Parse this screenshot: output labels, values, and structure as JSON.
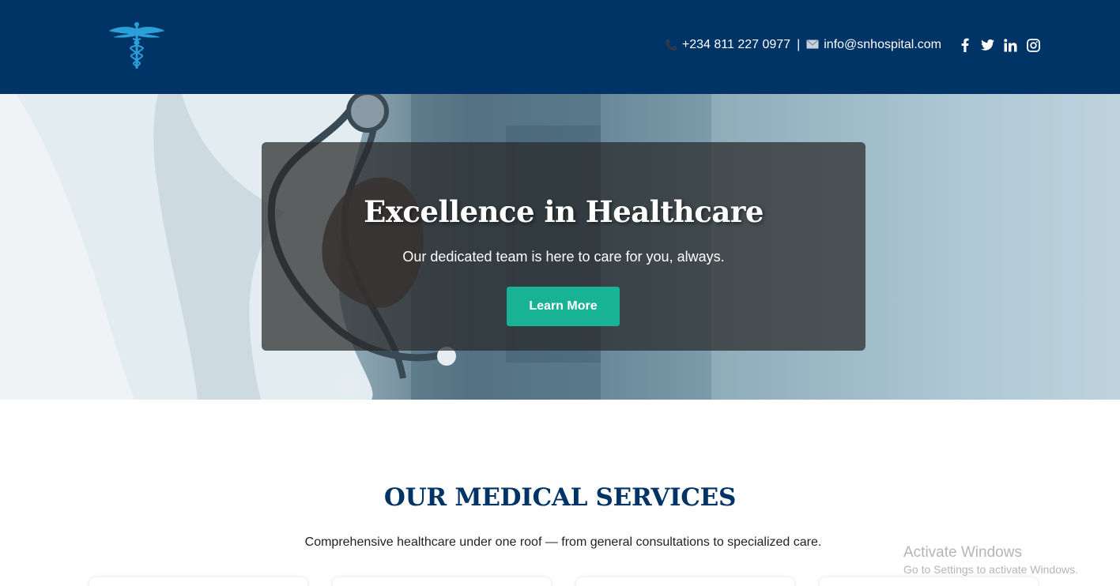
{
  "header": {
    "phone": "+234 811 227 0977",
    "separator": "|",
    "email": "info@snhospital.com",
    "social": [
      "facebook-icon",
      "twitter-icon",
      "linkedin-icon",
      "instagram-icon"
    ],
    "bg_color": "#003366"
  },
  "hero": {
    "title": "Excellence in Healthcare",
    "subtitle": "Our dedicated team is here to care for you, always.",
    "button_label": "Learn More",
    "button_color": "#17b394"
  },
  "services": {
    "title": "OUR MEDICAL SERVICES",
    "subtitle": "Comprehensive healthcare under one roof — from general consultations to specialized care."
  },
  "watermark": {
    "line1": "Activate Windows",
    "line2": "Go to Settings to activate Windows."
  }
}
